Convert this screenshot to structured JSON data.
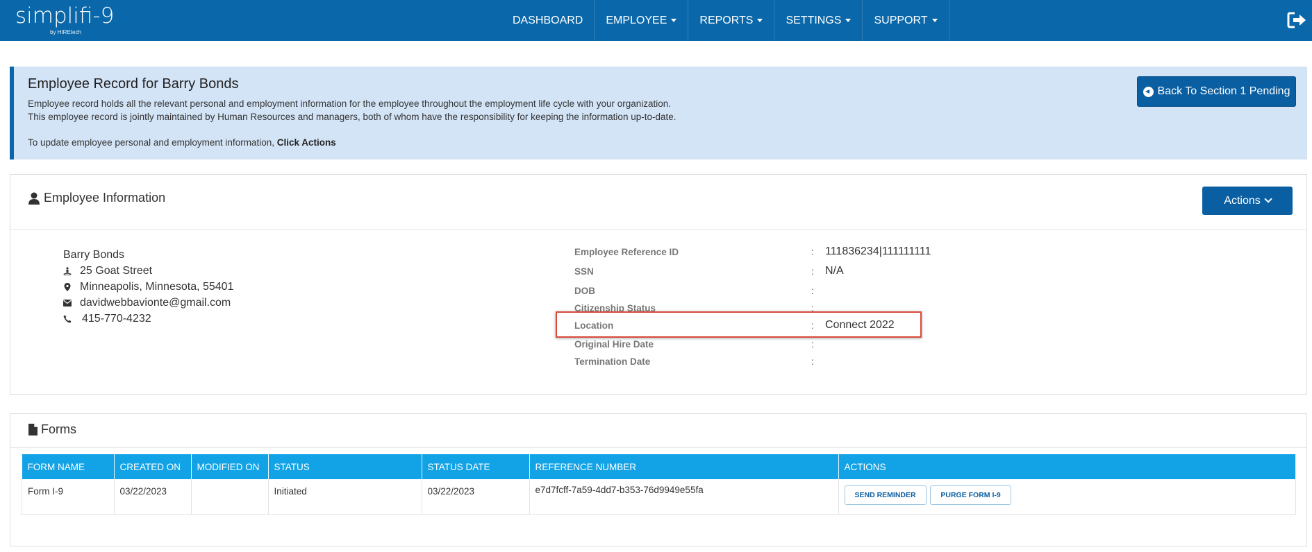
{
  "app": {
    "logo_text": "simplifi-9",
    "logo_sub": "by HIREtech"
  },
  "nav": {
    "items": [
      {
        "label": "DASHBOARD",
        "dropdown": false
      },
      {
        "label": "EMPLOYEE",
        "dropdown": true
      },
      {
        "label": "REPORTS",
        "dropdown": true
      },
      {
        "label": "SETTINGS",
        "dropdown": true
      },
      {
        "label": "SUPPORT",
        "dropdown": true
      }
    ],
    "logout_icon": "sign-out-icon"
  },
  "banner": {
    "title": "Employee Record for Barry Bonds",
    "line1": "Employee record holds all the relevant personal and employment information for the employee throughout the employment life cycle with your organization.",
    "line2": "This employee record is jointly maintained by Human Resources and managers, both of whom have the responsibility for keeping the information up-to-date.",
    "line3_prefix": "To update employee personal and employment information, ",
    "line3_bold": "Click Actions",
    "back_button": "Back To Section 1 Pending"
  },
  "employee_panel": {
    "title": "Employee Information",
    "actions_label": "Actions",
    "name": "Barry Bonds",
    "street": "25 Goat Street",
    "city": "Minneapolis, Minnesota, 55401",
    "email": "davidwebbavionte@gmail.com",
    "phone": "415-770-4232",
    "fields": [
      {
        "label": "Employee Reference ID",
        "value": "111836234|111111111"
      },
      {
        "label": "SSN",
        "value": "N/A"
      },
      {
        "label": "DOB",
        "value": ""
      },
      {
        "label": "Citizenship Status",
        "value": ""
      },
      {
        "label": "Location",
        "value": "Connect 2022"
      },
      {
        "label": "Original Hire Date",
        "value": ""
      },
      {
        "label": "Termination Date",
        "value": ""
      }
    ],
    "separator": ":"
  },
  "forms_panel": {
    "title": "Forms",
    "columns": [
      "FORM NAME",
      "CREATED ON",
      "MODIFIED ON",
      "STATUS",
      "STATUS DATE",
      "REFERENCE NUMBER",
      "ACTIONS"
    ],
    "rows": [
      {
        "form_name": "Form I-9",
        "created_on": "03/22/2023",
        "modified_on": "",
        "status": "Initiated",
        "status_date": "03/22/2023",
        "reference_number": "e7d7fcff-7a59-4dd7-b353-76d9949e55fa",
        "actions": [
          "SEND REMINDER",
          "PURGE FORM I-9"
        ]
      }
    ]
  },
  "colors": {
    "nav_bg": "#0a68aa",
    "banner_bg": "#d3e4f7",
    "table_header": "#12a3e6",
    "highlight": "#d9493b"
  }
}
